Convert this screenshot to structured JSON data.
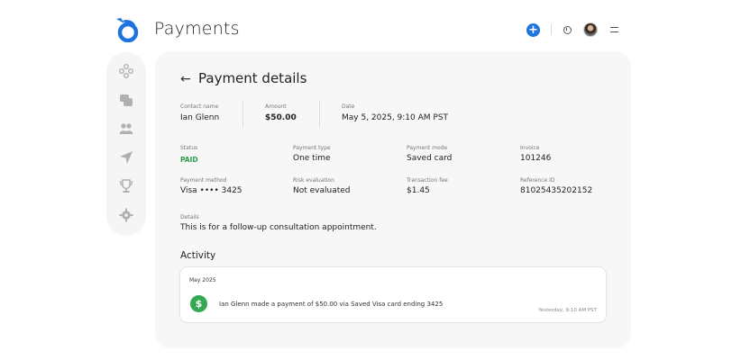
{
  "header": {
    "app_title": "Payments",
    "logo_icon": "bird-logo-icon",
    "brand_color": "#1f73e0"
  },
  "sidebar": {
    "items": [
      {
        "icon": "apps-icon"
      },
      {
        "icon": "chat-icon"
      },
      {
        "icon": "users-icon"
      },
      {
        "icon": "send-icon"
      },
      {
        "icon": "trophy-icon"
      },
      {
        "icon": "gear-icon"
      }
    ]
  },
  "page": {
    "title": "Payment details"
  },
  "summary": {
    "contact_label": "Contact name",
    "contact_value": "Ian Glenn",
    "amount_label": "Amount",
    "amount_value": "$50.00",
    "date_label": "Date",
    "date_value": "May 5, 2025, 9:10 AM PST"
  },
  "grid": {
    "status_label": "Status",
    "status_value": "PAID",
    "status_color": "#2e9e4a",
    "type_label": "Payment type",
    "type_value": "One time",
    "mode_label": "Payment mode",
    "mode_value": "Saved card",
    "invoice_label": "Invoice",
    "invoice_value": "101246",
    "method_label": "Payment method",
    "method_value": "Visa •••• 3425",
    "risk_label": "Risk evaluation",
    "risk_value": "Not evaluated",
    "fee_label": "Transaction fee",
    "fee_value": "$1.45",
    "ref_label": "Reference ID",
    "ref_value": "81025435202152"
  },
  "details": {
    "label": "Details",
    "value": "This is for a follow-up consultation appointment."
  },
  "activity": {
    "title": "Activity",
    "month": "May 2025",
    "items": [
      {
        "text": "Ian Glenn made a payment of $50.00 via Saved Visa card ending 3425",
        "time": "Yesterday, 9:10 AM PST",
        "icon": "dollar-icon"
      }
    ]
  }
}
